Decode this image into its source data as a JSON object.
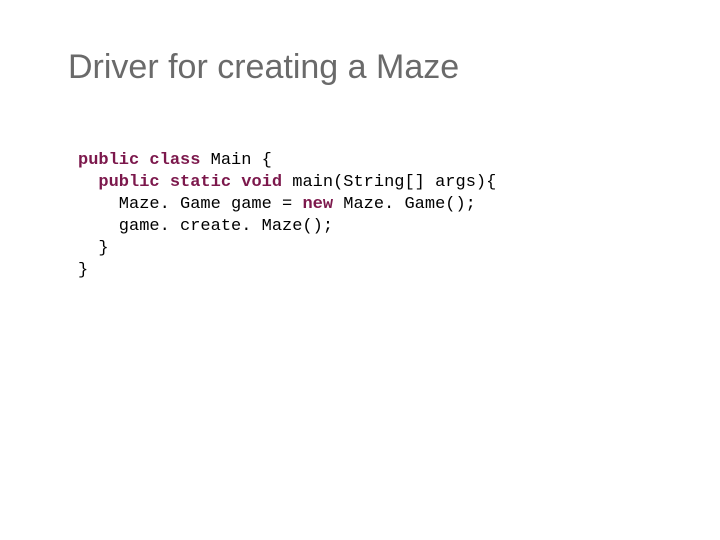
{
  "title": "Driver for creating a Maze",
  "code": {
    "kw_public": "public",
    "kw_class": "class",
    "kw_static": "static",
    "kw_void": "void",
    "kw_new": "new",
    "line1_rest": " Main {",
    "line2_rest": " main(String[] args){",
    "line3_pre": "    Maze. Game game = ",
    "line3_post": " Maze. Game();",
    "line4": "    game. create. Maze();",
    "line5": "  }",
    "line6": "}"
  }
}
